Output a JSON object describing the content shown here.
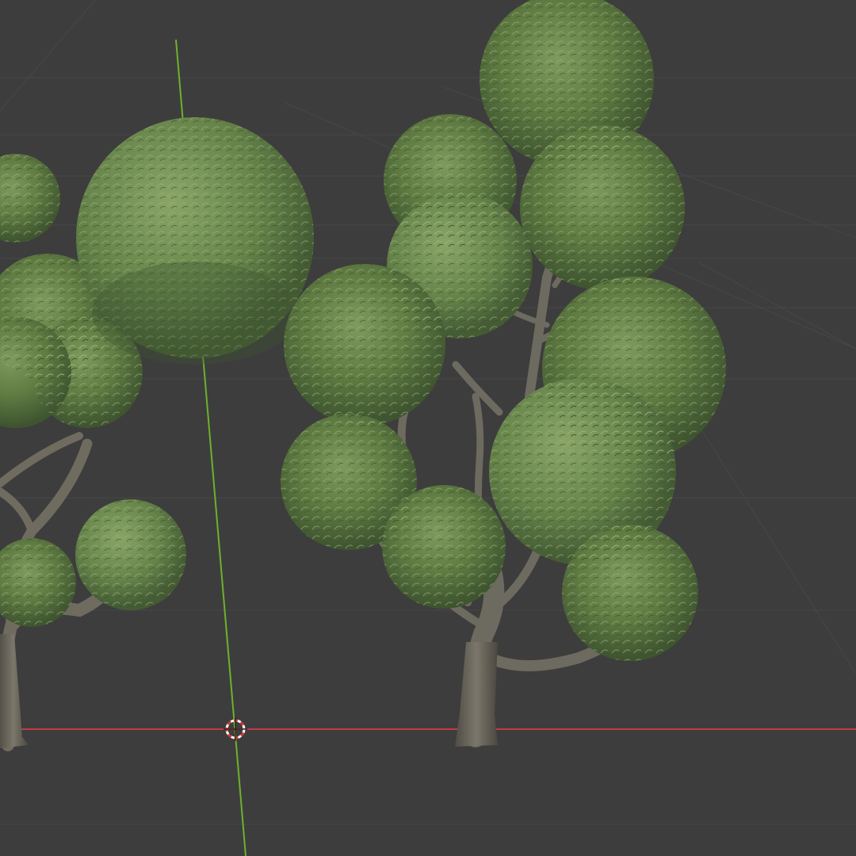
{
  "viewport": {
    "background": "#3d3d3d",
    "grid_color": "#4a4a4a",
    "x_axis_color": "#c23a45",
    "y_axis_color": "#6db12c",
    "cursor_colors": [
      "#d23c3c",
      "#ffffff"
    ]
  },
  "scene": {
    "objects": [
      {
        "name": "bonsai-tree-left",
        "type": "tree",
        "foliage_color": "#5d7a3f"
      },
      {
        "name": "round-tree-middle",
        "type": "tree",
        "foliage_color": "#637f44"
      },
      {
        "name": "bonsai-tree-large-right",
        "type": "tree",
        "foliage_color": "#5f7b42"
      }
    ],
    "bark_color": "#6d6a5f"
  }
}
